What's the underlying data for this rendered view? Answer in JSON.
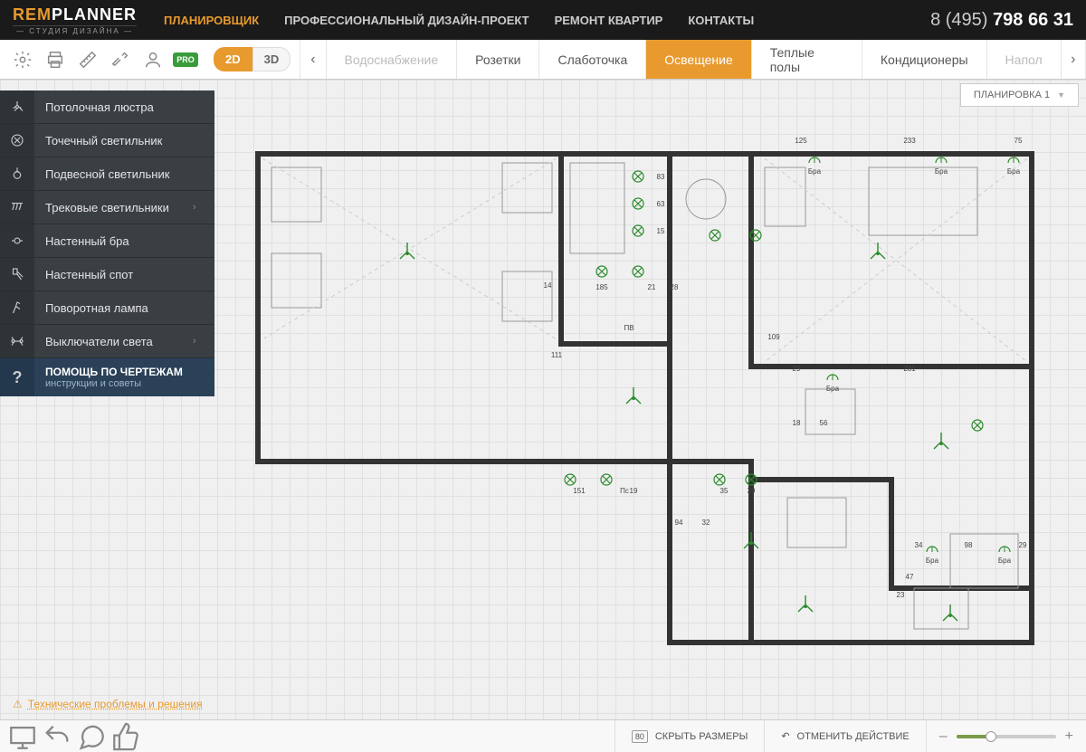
{
  "logo": {
    "prefix": "REM",
    "suffix": "PLANNER",
    "sub": "— СТУДИЯ ДИЗАЙНА —"
  },
  "nav": {
    "items": [
      "ПЛАНИРОВЩИК",
      "ПРОФЕССИОНАЛЬНЫЙ ДИЗАЙН-ПРОЕКТ",
      "РЕМОНТ КВАРТИР",
      "КОНТАКТЫ"
    ]
  },
  "phone": {
    "prefix": "8 (495) ",
    "number": "798 66 31"
  },
  "pro_badge": "PRO",
  "view": {
    "d2": "2D",
    "d3": "3D"
  },
  "tabs": {
    "items": [
      "Водоснабжение",
      "Розетки",
      "Слаботочка",
      "Освещение",
      "Теплые полы",
      "Кондиционеры",
      "Напол"
    ],
    "active_index": 3,
    "faded_index": 0
  },
  "layout_dropdown": "ПЛАНИРОВКА 1",
  "sidebar": {
    "items": [
      {
        "label": "Потолочная люстра",
        "expand": false
      },
      {
        "label": "Точечный светильник",
        "expand": false
      },
      {
        "label": "Подвесной светильник",
        "expand": false
      },
      {
        "label": "Трековые светильники",
        "expand": true
      },
      {
        "label": "Настенный бра",
        "expand": false
      },
      {
        "label": "Настенный спот",
        "expand": false
      },
      {
        "label": "Поворотная лампа",
        "expand": false
      },
      {
        "label": "Выключатели света",
        "expand": true
      }
    ],
    "help": {
      "title": "ПОМОЩЬ ПО ЧЕРТЕЖАМ",
      "sub": "инструкции и советы"
    }
  },
  "plan": {
    "dims_top": [
      "125",
      "233",
      "75"
    ],
    "labels": [
      "Бра",
      "Бра",
      "Бра",
      "Бра",
      "Бра",
      "Бра",
      "ПВ",
      "Пс"
    ],
    "dims": [
      "83",
      "63",
      "15",
      "185",
      "21",
      "28",
      "14",
      "111",
      "109",
      "29",
      "281",
      "151",
      "94",
      "32",
      "35",
      "39",
      "18",
      "56",
      "19",
      "34",
      "98",
      "29",
      "47",
      "23"
    ]
  },
  "tech_link": "Технические проблемы и решения",
  "footer": {
    "hide_sizes": {
      "badge": "80",
      "label": "СКРЫТЬ РАЗМЕРЫ"
    },
    "undo": "ОТМЕНИТЬ ДЕЙСТВИЕ",
    "zoom_minus": "–",
    "zoom_plus": "+"
  }
}
